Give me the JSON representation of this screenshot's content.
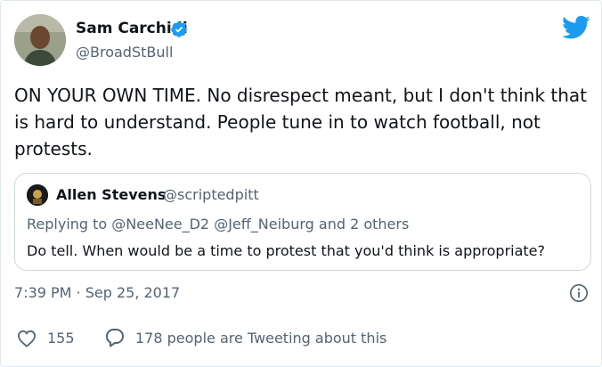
{
  "author": {
    "name": "Sam Carchidi",
    "handle": "@BroadStBull",
    "verified": true
  },
  "tweet": {
    "text": "ON YOUR OWN TIME. No disrespect meant, but I don't think that is hard to understand. People tune in to watch football, not protests.",
    "timestamp": "7:39 PM · Sep 25, 2017"
  },
  "quoted": {
    "name": "Allen Stevens",
    "handle": "@scriptedpitt",
    "replying_prefix": "Replying to",
    "replying_mentions": "@NeeNee_D2 @Jeff_Neiburg",
    "replying_suffix": "and 2 others",
    "text": "Do tell. When would be a time to protest that you'd think is appropriate?"
  },
  "actions": {
    "likes": "155",
    "tweeting": "178 people are Tweeting about this"
  },
  "icons": {
    "brand": "twitter-bird-icon",
    "verified": "verified-badge-icon",
    "info": "info-icon",
    "like": "heart-icon",
    "reply": "speech-bubble-icon"
  },
  "colors": {
    "brand": "#1d9bf0",
    "text": "#0f1419",
    "muted": "#536471",
    "border": "#cfd9de"
  }
}
